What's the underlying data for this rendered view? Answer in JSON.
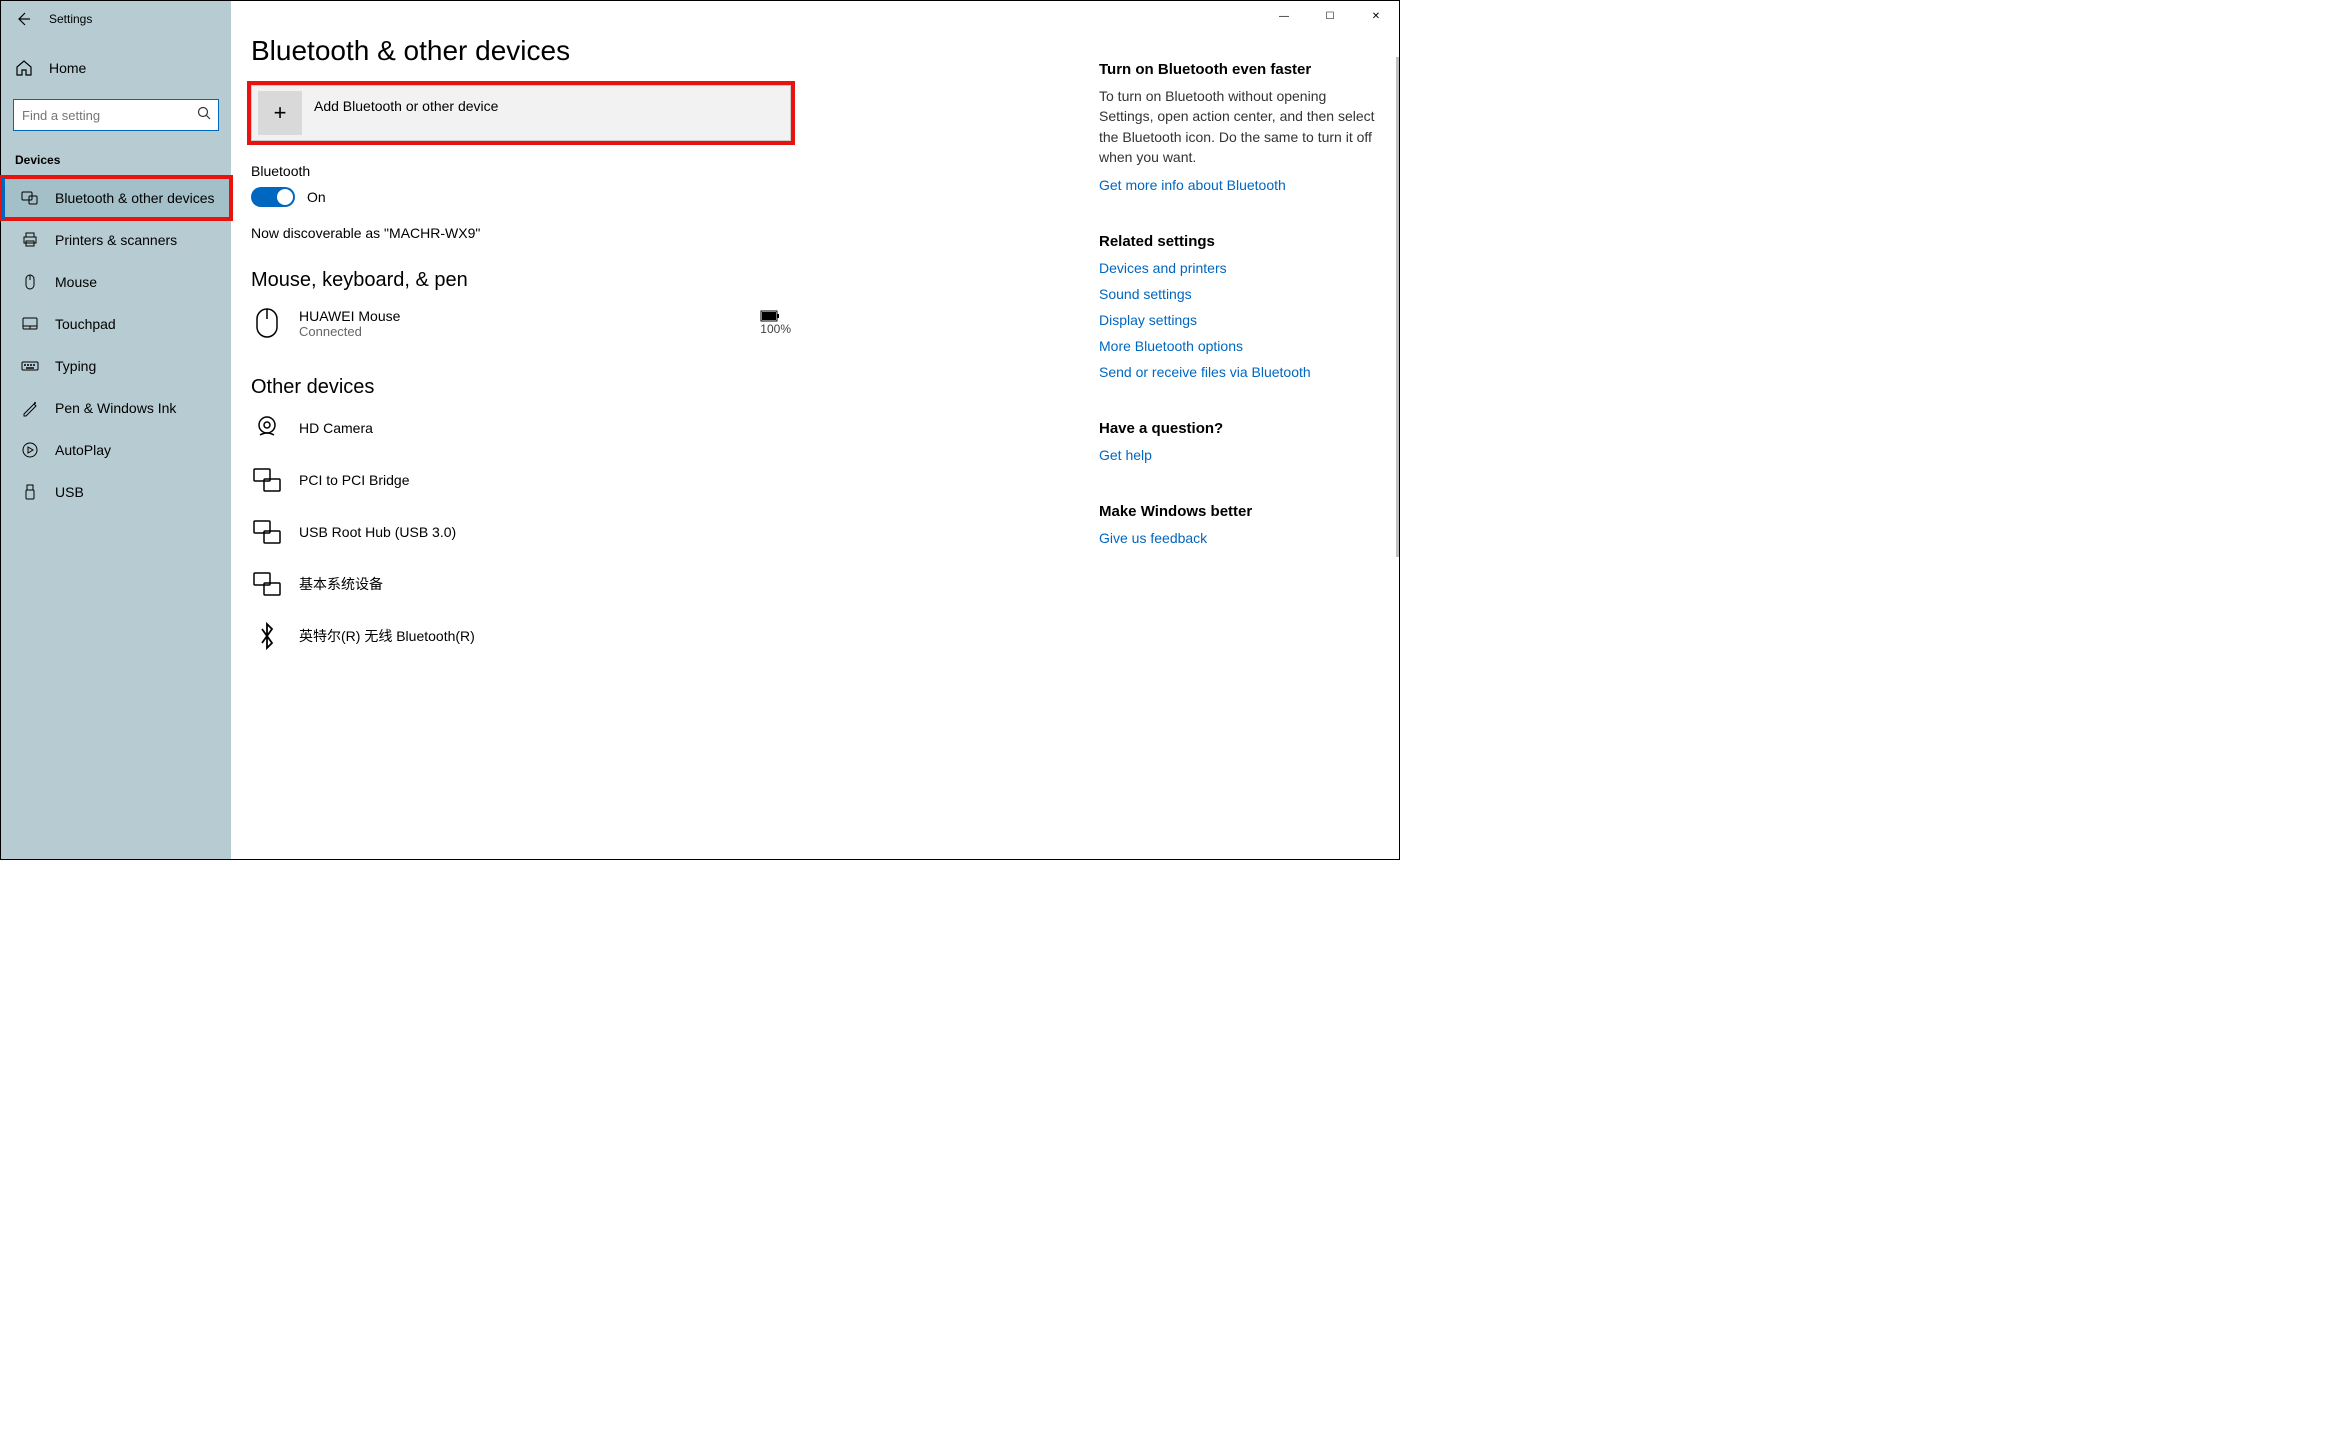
{
  "titlebar": {
    "minimize": "—",
    "maximize": "☐",
    "close": "✕"
  },
  "sidebar": {
    "app_title": "Settings",
    "home_label": "Home",
    "search_placeholder": "Find a setting",
    "group_label": "Devices",
    "items": [
      {
        "label": "Bluetooth & other devices"
      },
      {
        "label": "Printers & scanners"
      },
      {
        "label": "Mouse"
      },
      {
        "label": "Touchpad"
      },
      {
        "label": "Typing"
      },
      {
        "label": "Pen & Windows Ink"
      },
      {
        "label": "AutoPlay"
      },
      {
        "label": "USB"
      }
    ]
  },
  "main": {
    "page_title": "Bluetooth & other devices",
    "add_label": "Add Bluetooth or other device",
    "bt_section_label": "Bluetooth",
    "bt_state": "On",
    "discoverable_text": "Now discoverable as \"MACHR-WX9\"",
    "section_mouse": "Mouse, keyboard, & pen",
    "mouse_device": {
      "name": "HUAWEI  Mouse",
      "status": "Connected",
      "battery": "100%"
    },
    "section_other": "Other devices",
    "other_devices": [
      {
        "name": "HD Camera"
      },
      {
        "name": "PCI to PCI Bridge"
      },
      {
        "name": "USB Root Hub (USB 3.0)"
      },
      {
        "name": "基本系统设备"
      },
      {
        "name": "英特尔(R) 无线 Bluetooth(R)"
      }
    ]
  },
  "right": {
    "tip_head": "Turn on Bluetooth even faster",
    "tip_text": "To turn on Bluetooth without opening Settings, open action center, and then select the Bluetooth icon. Do the same to turn it off when you want.",
    "tip_link": "Get more info about Bluetooth",
    "related_head": "Related settings",
    "related_links": [
      "Devices and printers",
      "Sound settings",
      "Display settings",
      "More Bluetooth options",
      "Send or receive files via Bluetooth"
    ],
    "question_head": "Have a question?",
    "question_link": "Get help",
    "feedback_head": "Make Windows better",
    "feedback_link": "Give us feedback"
  }
}
